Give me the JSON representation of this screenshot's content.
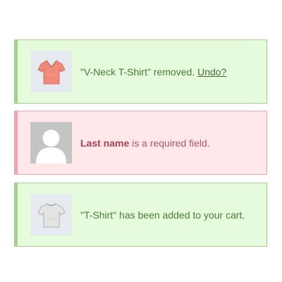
{
  "notices": {
    "removed": {
      "message_prefix": "\"V-Neck T-Shirt\" removed.",
      "undo_label": "Undo?",
      "thumbnail_icon": "vneck-tshirt-icon",
      "accent_color": "#a4cf8f"
    },
    "error": {
      "field_name": "Last name",
      "message_suffix": "is a required field.",
      "thumbnail_icon": "user-placeholder-icon",
      "accent_color": "#f0a5ad"
    },
    "added": {
      "message": "\"T-Shirt\" has been added to your cart.",
      "thumbnail_icon": "tshirt-icon",
      "accent_color": "#a4cf8f"
    }
  }
}
